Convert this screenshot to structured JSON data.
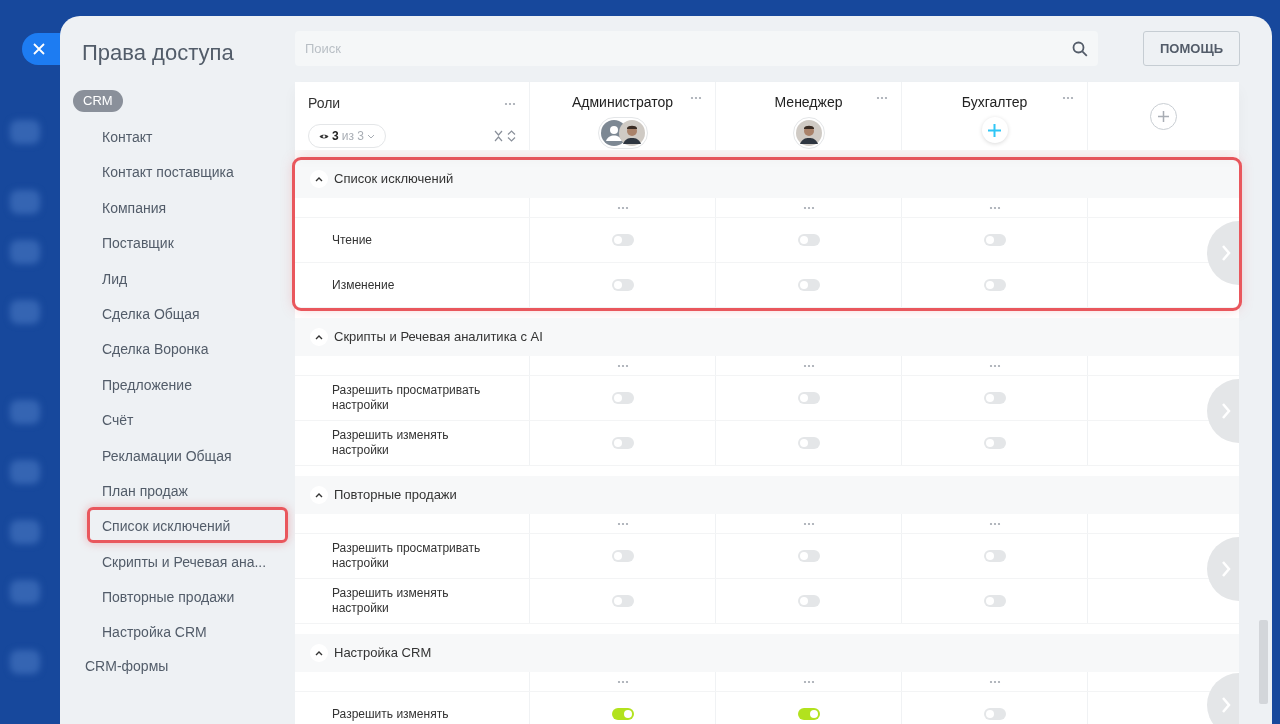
{
  "window": {
    "title": "Права доступа"
  },
  "search": {
    "placeholder": "Поиск"
  },
  "help_button": "ПОМОЩЬ",
  "sidebar": {
    "items": [
      {
        "label": "CRM",
        "kind": "group",
        "selected": true,
        "children": [
          {
            "label": "Контакт",
            "highlighted": false
          },
          {
            "label": "Контакт поставщика",
            "highlighted": false
          },
          {
            "label": "Компания",
            "highlighted": false
          },
          {
            "label": "Поставщик",
            "highlighted": false
          },
          {
            "label": "Лид",
            "highlighted": false
          },
          {
            "label": "Сделка Общая",
            "highlighted": false
          },
          {
            "label": "Сделка Воронка",
            "highlighted": false
          },
          {
            "label": "Предложение",
            "highlighted": false
          },
          {
            "label": "Счёт",
            "highlighted": false
          },
          {
            "label": "Рекламации Общая",
            "highlighted": false
          },
          {
            "label": "План продаж",
            "highlighted": false
          },
          {
            "label": "Список исключений",
            "highlighted": true
          },
          {
            "label": "Скрипты и Речевая ана...",
            "highlighted": false
          },
          {
            "label": "Повторные продажи",
            "highlighted": false
          },
          {
            "label": "Настройка CRM",
            "highlighted": false
          }
        ]
      },
      {
        "label": "CRM-формы",
        "kind": "link",
        "selected": false
      }
    ]
  },
  "table": {
    "roles_header": {
      "title": "Роли",
      "visible_count": "3",
      "of_total": "из 3"
    },
    "roles": [
      {
        "name": "Администратор",
        "members": [
          {
            "kind": "silhouette"
          },
          {
            "kind": "photo"
          }
        ]
      },
      {
        "name": "Менеджер",
        "members": [
          {
            "kind": "photo"
          }
        ]
      },
      {
        "name": "Бухгалтер"
      }
    ],
    "sections": [
      {
        "title": "Список исключений",
        "expanded": true,
        "highlighted": true,
        "rows": [
          {
            "label": "Чтение",
            "toggles": [
              {
                "on": false
              },
              {
                "on": false
              },
              {
                "on": false
              }
            ]
          },
          {
            "label": "Изменение",
            "toggles": [
              {
                "on": false
              },
              {
                "on": false
              },
              {
                "on": false
              }
            ]
          }
        ]
      },
      {
        "title": "Скрипты и Речевая аналитика с AI",
        "expanded": true,
        "highlighted": false,
        "rows": [
          {
            "label": "Разрешить просматривать настройки",
            "toggles": [
              {
                "on": false
              },
              {
                "on": false
              },
              {
                "on": false
              }
            ]
          },
          {
            "label": "Разрешить изменять настройки",
            "toggles": [
              {
                "on": false
              },
              {
                "on": false
              },
              {
                "on": false
              }
            ]
          }
        ]
      },
      {
        "title": "Повторные продажи",
        "expanded": true,
        "highlighted": false,
        "rows": [
          {
            "label": "Разрешить просматривать настройки",
            "toggles": [
              {
                "on": false
              },
              {
                "on": false
              },
              {
                "on": false
              }
            ]
          },
          {
            "label": "Разрешить изменять настройки",
            "toggles": [
              {
                "on": false
              },
              {
                "on": false
              },
              {
                "on": false
              }
            ]
          }
        ]
      },
      {
        "title": "Настройка CRM",
        "expanded": true,
        "highlighted": false,
        "rows": [
          {
            "label": "Разрешить изменять",
            "toggles": [
              {
                "on": true
              },
              {
                "on": true
              },
              {
                "on": false
              }
            ]
          }
        ]
      }
    ]
  }
}
